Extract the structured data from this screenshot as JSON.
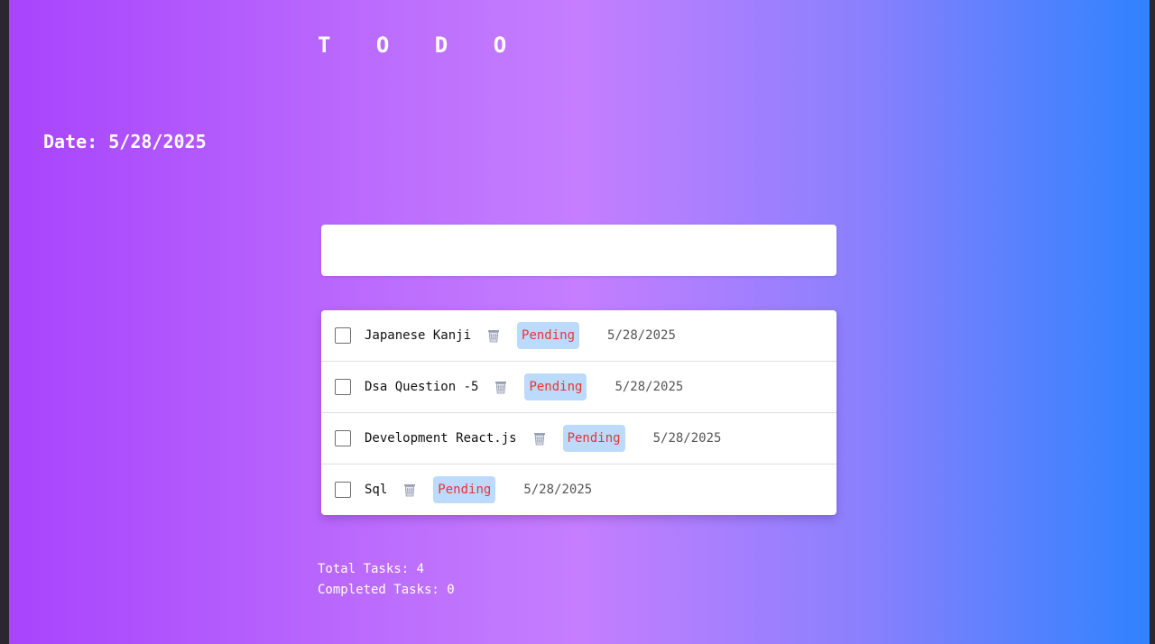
{
  "app": {
    "title": "T O D O",
    "date_label": "Date: 5/28/2025"
  },
  "input": {
    "value": "",
    "placeholder": ""
  },
  "tasks": [
    {
      "name": "Japanese Kanji",
      "status": "Pending",
      "date": "5/28/2025",
      "completed": false
    },
    {
      "name": "Dsa Question -5",
      "status": "Pending",
      "date": "5/28/2025",
      "completed": false
    },
    {
      "name": "Development React.js",
      "status": "Pending",
      "date": "5/28/2025",
      "completed": false
    },
    {
      "name": "Sql",
      "status": "Pending",
      "date": "5/28/2025",
      "completed": false
    }
  ],
  "stats": {
    "total_label": "Total Tasks: 4",
    "completed_label": "Completed Tasks: 0"
  },
  "icons": {
    "delete": "trash-icon"
  },
  "colors": {
    "gradient_start": "#a844fd",
    "gradient_mid": "#c57efe",
    "gradient_end": "#2f82fe",
    "status_bg": "#bcdafb",
    "status_text": "#e53636"
  }
}
